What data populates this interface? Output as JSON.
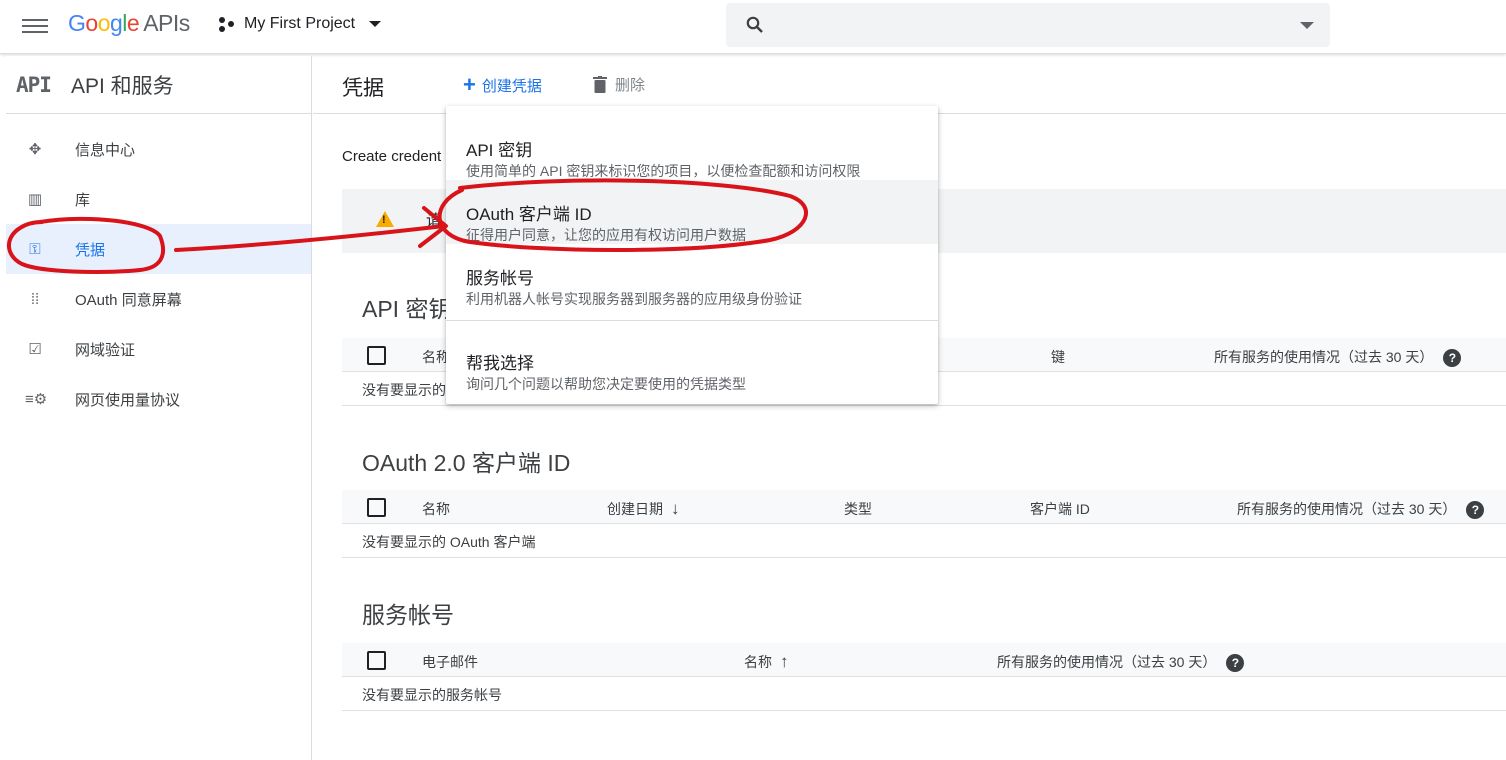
{
  "header": {
    "logo_google": "Google",
    "logo_apis": "APIs",
    "project_name": "My First Project",
    "search_placeholder": ""
  },
  "sidebar": {
    "badge": "API",
    "title": "API 和服务",
    "items": [
      {
        "label": "信息中心",
        "icon": "dashboard-icon",
        "glyph": "✥",
        "active": false
      },
      {
        "label": "库",
        "icon": "library-icon",
        "glyph": "▥",
        "active": false
      },
      {
        "label": "凭据",
        "icon": "key-icon",
        "glyph": "⚿",
        "active": true
      },
      {
        "label": "OAuth 同意屏幕",
        "icon": "consent-icon",
        "glyph": "⁞⁞",
        "active": false
      },
      {
        "label": "网域验证",
        "icon": "checkbox-icon",
        "glyph": "☑",
        "active": false
      },
      {
        "label": "网页使用量协议",
        "icon": "settings-list-icon",
        "glyph": "≡⚙",
        "active": false
      }
    ]
  },
  "main": {
    "title": "凭据",
    "create_label": "创建凭据",
    "delete_label": "删除",
    "intro_text": "Create credent",
    "warning_text": "请",
    "api_keys": {
      "title": "API 密钥",
      "columns": [
        "名称",
        "键",
        "所有服务的使用情况（过去 30 天）"
      ],
      "empty_text": "没有要显示的"
    },
    "oauth": {
      "title": "OAuth 2.0 客户端 ID",
      "columns": [
        "名称",
        "创建日期",
        "类型",
        "客户端 ID",
        "所有服务的使用情况（过去 30 天）"
      ],
      "empty_text": "没有要显示的 OAuth 客户端"
    },
    "service_accounts": {
      "title": "服务帐号",
      "columns": [
        "电子邮件",
        "名称",
        "所有服务的使用情况（过去 30 天）"
      ],
      "empty_text": "没有要显示的服务帐号"
    }
  },
  "create_menu": {
    "items": [
      {
        "title": "API 密钥",
        "desc": "使用简单的 API 密钥来标识您的项目，以便检查配额和访问权限"
      },
      {
        "title": "OAuth 客户端 ID",
        "desc": "征得用户同意，让您的应用有权访问用户数据"
      },
      {
        "title": "服务帐号",
        "desc": "利用机器人帐号实现服务器到服务器的应用级身份验证"
      },
      {
        "title": "帮我选择",
        "desc": "询问几个问题以帮助您决定要使用的凭据类型"
      }
    ]
  },
  "colors": {
    "accent": "#1a73e8",
    "annotation": "#d8141a",
    "warning": "#f9ab00"
  }
}
